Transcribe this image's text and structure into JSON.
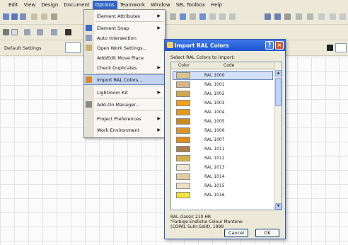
{
  "menubar": {
    "items": [
      "Edit",
      "View",
      "Design",
      "Document",
      "Options",
      "Teamwork",
      "Window",
      "SEL Toolbox",
      "Help"
    ],
    "active_index": 4
  },
  "toolbar": {
    "settings_label": "Default Settings"
  },
  "options_menu": {
    "items": [
      {
        "label": "Element Attributes",
        "submenu": true
      },
      {
        "label": "Element Snap",
        "submenu": true
      },
      {
        "label": "Auto Intersection",
        "submenu": false
      },
      {
        "label": "Open Work Settings...",
        "submenu": false
      },
      {
        "label": "Add/Edit Move Place",
        "submenu": false
      },
      {
        "label": "Check Duplicates",
        "submenu": true
      },
      {
        "label": "Import RAL Colors...",
        "submenu": false,
        "highlighted": true
      },
      {
        "label": "Lightroom Kit",
        "submenu": true
      },
      {
        "label": "Add-On Manager...",
        "submenu": false
      },
      {
        "label": "Project Preferences",
        "submenu": true
      },
      {
        "label": "Work Environment",
        "submenu": true
      }
    ]
  },
  "dialog": {
    "title": "Import RAL Colors",
    "help_glyph": "?",
    "close_glyph": "×",
    "prompt": "Select RAL Colors to import:",
    "columns": [
      "Color",
      "Code"
    ],
    "colors": [
      {
        "code": "RAL 1000",
        "hex": "#d8c48f",
        "selected": true
      },
      {
        "code": "RAL 1001",
        "hex": "#d4b38a"
      },
      {
        "code": "RAL 1002",
        "hex": "#cfa84f"
      },
      {
        "code": "RAL 1003",
        "hex": "#f0a21b"
      },
      {
        "code": "RAL 1004",
        "hex": "#e09b1e"
      },
      {
        "code": "RAL 1005",
        "hex": "#c88b1f"
      },
      {
        "code": "RAL 1006",
        "hex": "#de9428"
      },
      {
        "code": "RAL 1007",
        "hex": "#df8e1b"
      },
      {
        "code": "RAL 1011",
        "hex": "#a87f4e"
      },
      {
        "code": "RAL 1012",
        "hex": "#d3b148"
      },
      {
        "code": "RAL 1013",
        "hex": "#ece5cf"
      },
      {
        "code": "RAL 1014",
        "hex": "#e0cc9e"
      },
      {
        "code": "RAL 1015",
        "hex": "#ece1c4"
      },
      {
        "code": "RAL 1016",
        "hex": "#f5e43b"
      }
    ],
    "info_lines": [
      "RAL classic 210 HR",
      "\"Farbige Endliche Colour Mantene",
      "(COPAL Suhr-Galit), 1999"
    ],
    "cancel_label": "Cancel",
    "ok_label": "OK"
  },
  "colors": {
    "menu_highlight": "#3163c6",
    "title_bar": "#1d52cf",
    "selection": "#d4e0f7"
  }
}
